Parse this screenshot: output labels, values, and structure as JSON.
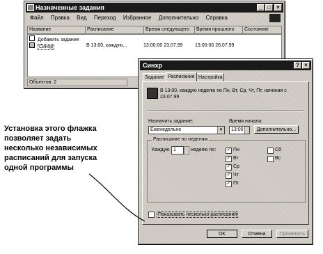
{
  "main_window": {
    "title": "Назначенные задания",
    "menu": [
      "Файл",
      "Правка",
      "Вид",
      "Переход",
      "Избранное",
      "Дополнительно",
      "Справка"
    ],
    "columns": [
      "Название",
      "Расписание",
      "Время следующего",
      "Время прошлого",
      "Состояние"
    ],
    "rows": [
      {
        "name": "Добавить задание",
        "schedule": "",
        "next": "",
        "last": ""
      },
      {
        "name": "Синхр",
        "schedule": "В 13:00, каждую...",
        "next": "13:00:00 23.07.99",
        "last": "13:00:00 28.07.99"
      }
    ],
    "status": "Объектов: 2"
  },
  "dialog": {
    "title": "Синхр",
    "tabs": [
      "Задание",
      "Расписание",
      "Настройка"
    ],
    "schedule_summary": "В 13:00, каждую неделю по Пн, Вт, Ср, Чт, Пт, начиная с 23.07.99",
    "schedule_label": "Назначить задание:",
    "schedule_value": "Еженедельно",
    "start_time_label": "Время начала:",
    "start_time_value": "13:00",
    "advanced_button": "Дополнительно...",
    "group_label": "Расписание по неделям",
    "every_label": "Каждую",
    "every_value": "1",
    "weeks_label": "неделю по:",
    "days": [
      "Пн",
      "Вт",
      "Ср",
      "Чт",
      "Пт",
      "Сб",
      "Вс"
    ],
    "days_checked": [
      true,
      true,
      true,
      true,
      true,
      false,
      false
    ],
    "multi_checkbox_label": "Показывать несколько расписаний",
    "ok_button": "OK",
    "cancel_button": "Отмена",
    "apply_button": "Применить"
  },
  "callout": "Установка этого флажка позволяет задать несколько независимых расписаний для запуска одной программы"
}
